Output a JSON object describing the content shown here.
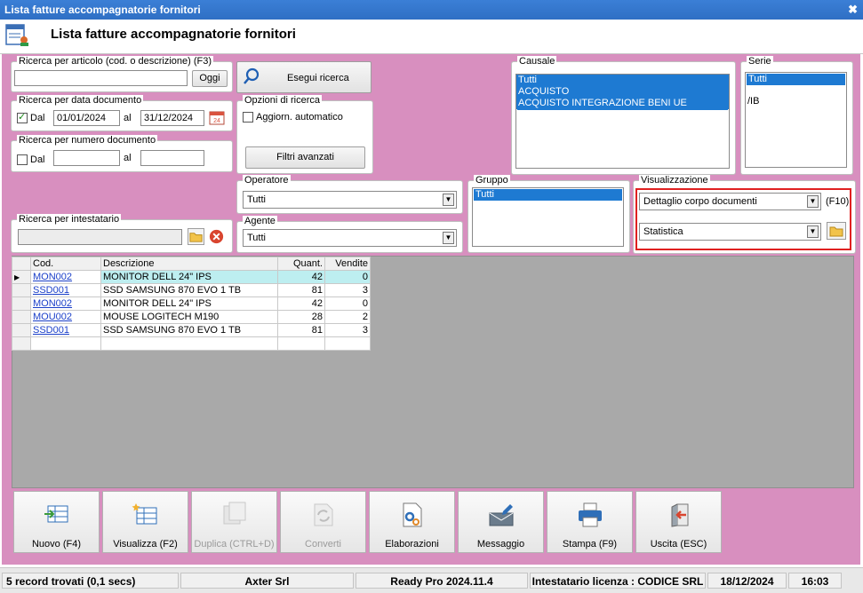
{
  "window": {
    "title": "Lista fatture accompagnatorie fornitori"
  },
  "header": {
    "title": "Lista fatture accompagnatorie fornitori"
  },
  "search_article": {
    "label": "Ricerca per articolo (cod. o descrizione) (F3)",
    "value": "",
    "button": "Oggi"
  },
  "search_date": {
    "label": "Ricerca per data documento",
    "from_label": "Dal",
    "from": "01/01/2024",
    "to_label": "al",
    "to": "31/12/2024",
    "checked": true
  },
  "search_number": {
    "label": "Ricerca per numero documento",
    "from_label": "Dal",
    "to_label": "al",
    "checked": false
  },
  "search_holder": {
    "label": "Ricerca per intestatario"
  },
  "search_button": "Esegui ricerca",
  "options": {
    "label": "Opzioni di ricerca",
    "auto_update": "Aggiorn. automatico",
    "advanced_filters": "Filtri avanzati"
  },
  "causale": {
    "label": "Causale",
    "items": [
      "Tutti",
      "ACQUISTO",
      "ACQUISTO INTEGRAZIONE BENI UE"
    ]
  },
  "serie": {
    "label": "Serie",
    "items": [
      "Tutti",
      "/IB"
    ]
  },
  "operatore": {
    "label": "Operatore",
    "value": "Tutti"
  },
  "agente": {
    "label": "Agente",
    "value": "Tutti"
  },
  "gruppo": {
    "label": "Gruppo",
    "items": [
      "Tutti"
    ]
  },
  "visualizzazione": {
    "label": "Visualizzazione",
    "mode": "Dettaglio corpo documenti",
    "shortcut": "(F10)",
    "view": "Statistica"
  },
  "table": {
    "headers": [
      "Cod.",
      "Descrizione",
      "Quant.",
      "Vendite"
    ],
    "rows": [
      {
        "cod": "MON002",
        "descr": "MONITOR DELL 24\" IPS",
        "qty": "42",
        "sales": "0"
      },
      {
        "cod": "SSD001",
        "descr": "SSD SAMSUNG 870 EVO 1 TB",
        "qty": "81",
        "sales": "3"
      },
      {
        "cod": "MON002",
        "descr": "MONITOR DELL 24\" IPS",
        "qty": "42",
        "sales": "0"
      },
      {
        "cod": "MOU002",
        "descr": "MOUSE LOGITECH M190",
        "qty": "28",
        "sales": "2"
      },
      {
        "cod": "SSD001",
        "descr": "SSD SAMSUNG 870 EVO 1 TB",
        "qty": "81",
        "sales": "3"
      }
    ]
  },
  "toolbar": {
    "new": "Nuovo (F4)",
    "view": "Visualizza (F2)",
    "duplicate": "Duplica (CTRL+D)",
    "convert": "Converti",
    "processing": "Elaborazioni",
    "message": "Messaggio",
    "print": "Stampa (F9)",
    "exit": "Uscita (ESC)"
  },
  "status": {
    "records": "5 record trovati (0,1 secs)",
    "company": "Axter Srl",
    "version": "Ready Pro 2024.11.4",
    "license": "Intestatario licenza : CODICE SRL",
    "date": "18/12/2024",
    "time": "16:03"
  },
  "colors": {
    "background": "#d88fbf",
    "selection": "#1e7ad2",
    "highlight_row": "#bdeef0",
    "accent_box": "#e02020"
  }
}
